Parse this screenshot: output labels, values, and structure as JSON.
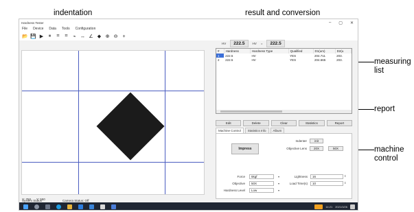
{
  "annotations": {
    "indentation": "indentation",
    "result": "result and conversion",
    "measuring_list": "measuring\nlist",
    "report": "report",
    "machine_control": "machine\ncontrol"
  },
  "app": {
    "title": "Hardness Tester",
    "window_controls": [
      "–",
      "▢",
      "✕"
    ],
    "menu": [
      "File",
      "Device",
      "Data",
      "Tools",
      "Configuration"
    ],
    "toolbar_icons": [
      "open-folder-icon",
      "save-icon",
      "play-icon",
      "pause-icon",
      "grid-icon",
      "cross-hatch-icon",
      "measure-icon",
      "line-icon",
      "angle-icon",
      "eraser-icon",
      "zoom-in-icon",
      "zoom-out-icon",
      "crosshair-icon"
    ],
    "toolbar_glyphs": [
      "📂",
      "💾",
      "▶",
      "⏸",
      "⌗",
      "⌗",
      "⌁",
      "↔",
      "∠",
      "◆",
      "⊕",
      "⊖",
      "+"
    ]
  },
  "result": {
    "left_label": "HV",
    "value": "222.5",
    "unit": "HV",
    "eq": "=",
    "converted": "222.5"
  },
  "list": {
    "columns": [
      "#",
      "Hardness",
      "Hardness Type",
      "Qualified",
      "D1(um)",
      "D2(u"
    ],
    "rows": [
      [
        "1",
        "222.5",
        "HV",
        "YES",
        "204.711",
        "203."
      ],
      [
        "2",
        "222.5",
        "HV",
        "YES",
        "204.665",
        "203."
      ]
    ]
  },
  "buttons": [
    "Edit",
    "Delete",
    "Clear",
    "Statistics",
    "Report"
  ],
  "tabs": [
    "Machine Control",
    "Statistics Info",
    "Album"
  ],
  "machine": {
    "impress": "Impress",
    "indenter_label": "Indenter",
    "indenter_value": "init",
    "objective_lens_label": "Objective Lens",
    "lens_10x": "20X",
    "lens_40x": "50X",
    "force_label": "Force",
    "force_value": "5kgf",
    "objective_label": "Objective",
    "objective_value": "50X",
    "lightness_label": "Lightness",
    "lightness_value": "16",
    "load_time_label": "Load Time(s)",
    "load_time_value": "10",
    "hardness_level_label": "Hardness Level",
    "hardness_level_value": "Low"
  },
  "coords": {
    "x": "X: 750",
    "y": "Y: 550"
  },
  "status": {
    "system": "System Status",
    "camera": "Camera Status: Off"
  },
  "tray": {
    "time": "14:21",
    "date": "2021/3/26"
  }
}
